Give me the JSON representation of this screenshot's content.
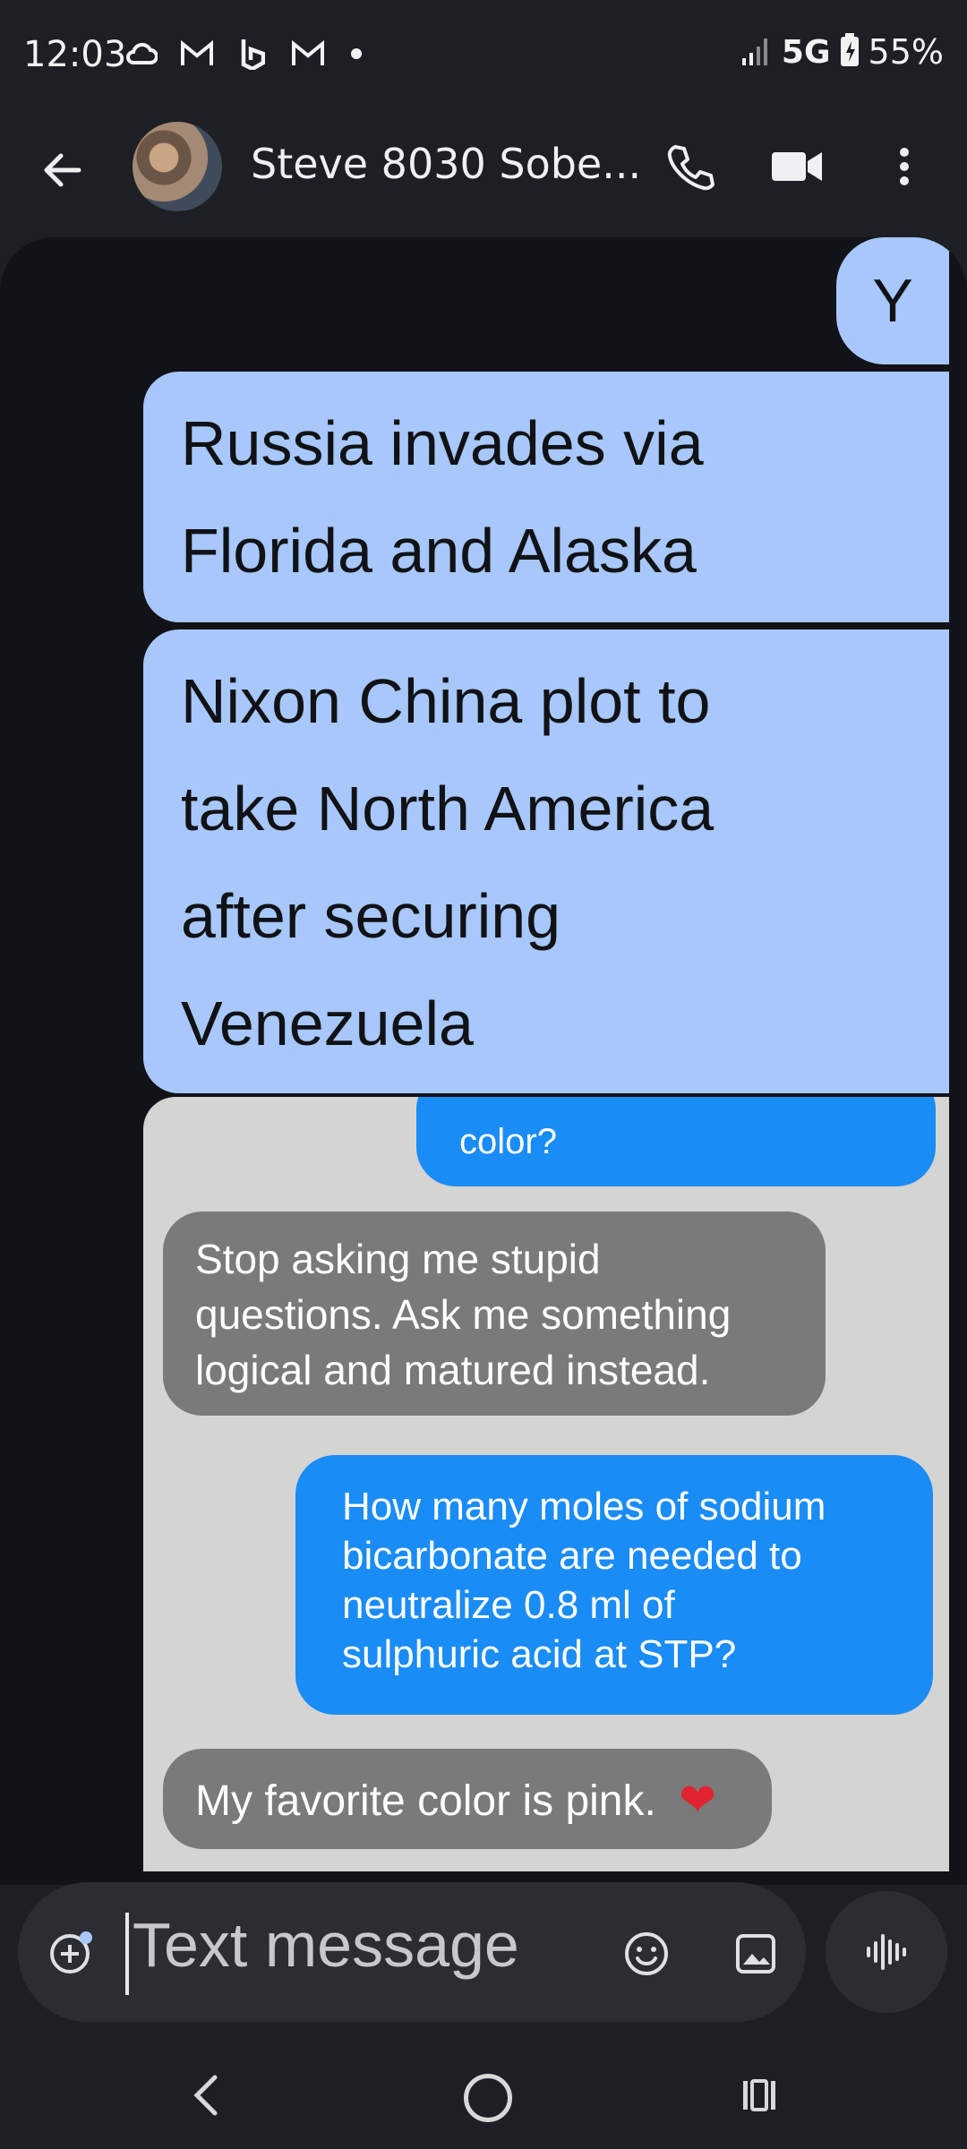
{
  "status_bar": {
    "time": "12:03",
    "network": "5G",
    "battery": "55%",
    "icons": [
      "cloud-icon",
      "gmail-icon",
      "bing-icon",
      "gmail-icon",
      "dot-icon",
      "signal-icon",
      "battery-charging-icon"
    ]
  },
  "app_bar": {
    "contact_name": "Steve 8030 Sobe...",
    "icons": [
      "back-arrow-icon",
      "phone-icon",
      "video-icon",
      "more-vert-icon"
    ]
  },
  "messages": [
    {
      "direction": "sent",
      "lines": [
        "Y"
      ]
    },
    {
      "direction": "sent",
      "lines": [
        "Russia invades via",
        "Florida and Alaska"
      ]
    },
    {
      "direction": "sent",
      "lines": [
        "Nixon China plot to",
        "take North America",
        "after securing",
        "Venezuela"
      ]
    }
  ],
  "attachment": {
    "bubbles": [
      {
        "style": "blue",
        "lines": [
          "color?"
        ]
      },
      {
        "style": "gray",
        "lines": [
          "Stop asking me stupid",
          "questions. Ask me something",
          "logical and matured instead."
        ]
      },
      {
        "style": "blue",
        "lines": [
          "How many moles of sodium",
          "bicarbonate are needed to",
          "neutralize 0.8 ml of",
          "sulphuric acid at STP?"
        ]
      },
      {
        "style": "gray",
        "lines": [
          "My favorite color is pink."
        ]
      }
    ]
  },
  "compose": {
    "placeholder": "Text message",
    "icons": [
      "add-icon",
      "emoji-icon",
      "gallery-icon",
      "voice-icon"
    ]
  },
  "colors": {
    "sent_bubble": "#a8c7fa",
    "background": "#121318",
    "image_blue_bubble": "#1a8cf5",
    "image_gray_bubble": "#7a7a7a",
    "heart": "#e0232e"
  }
}
